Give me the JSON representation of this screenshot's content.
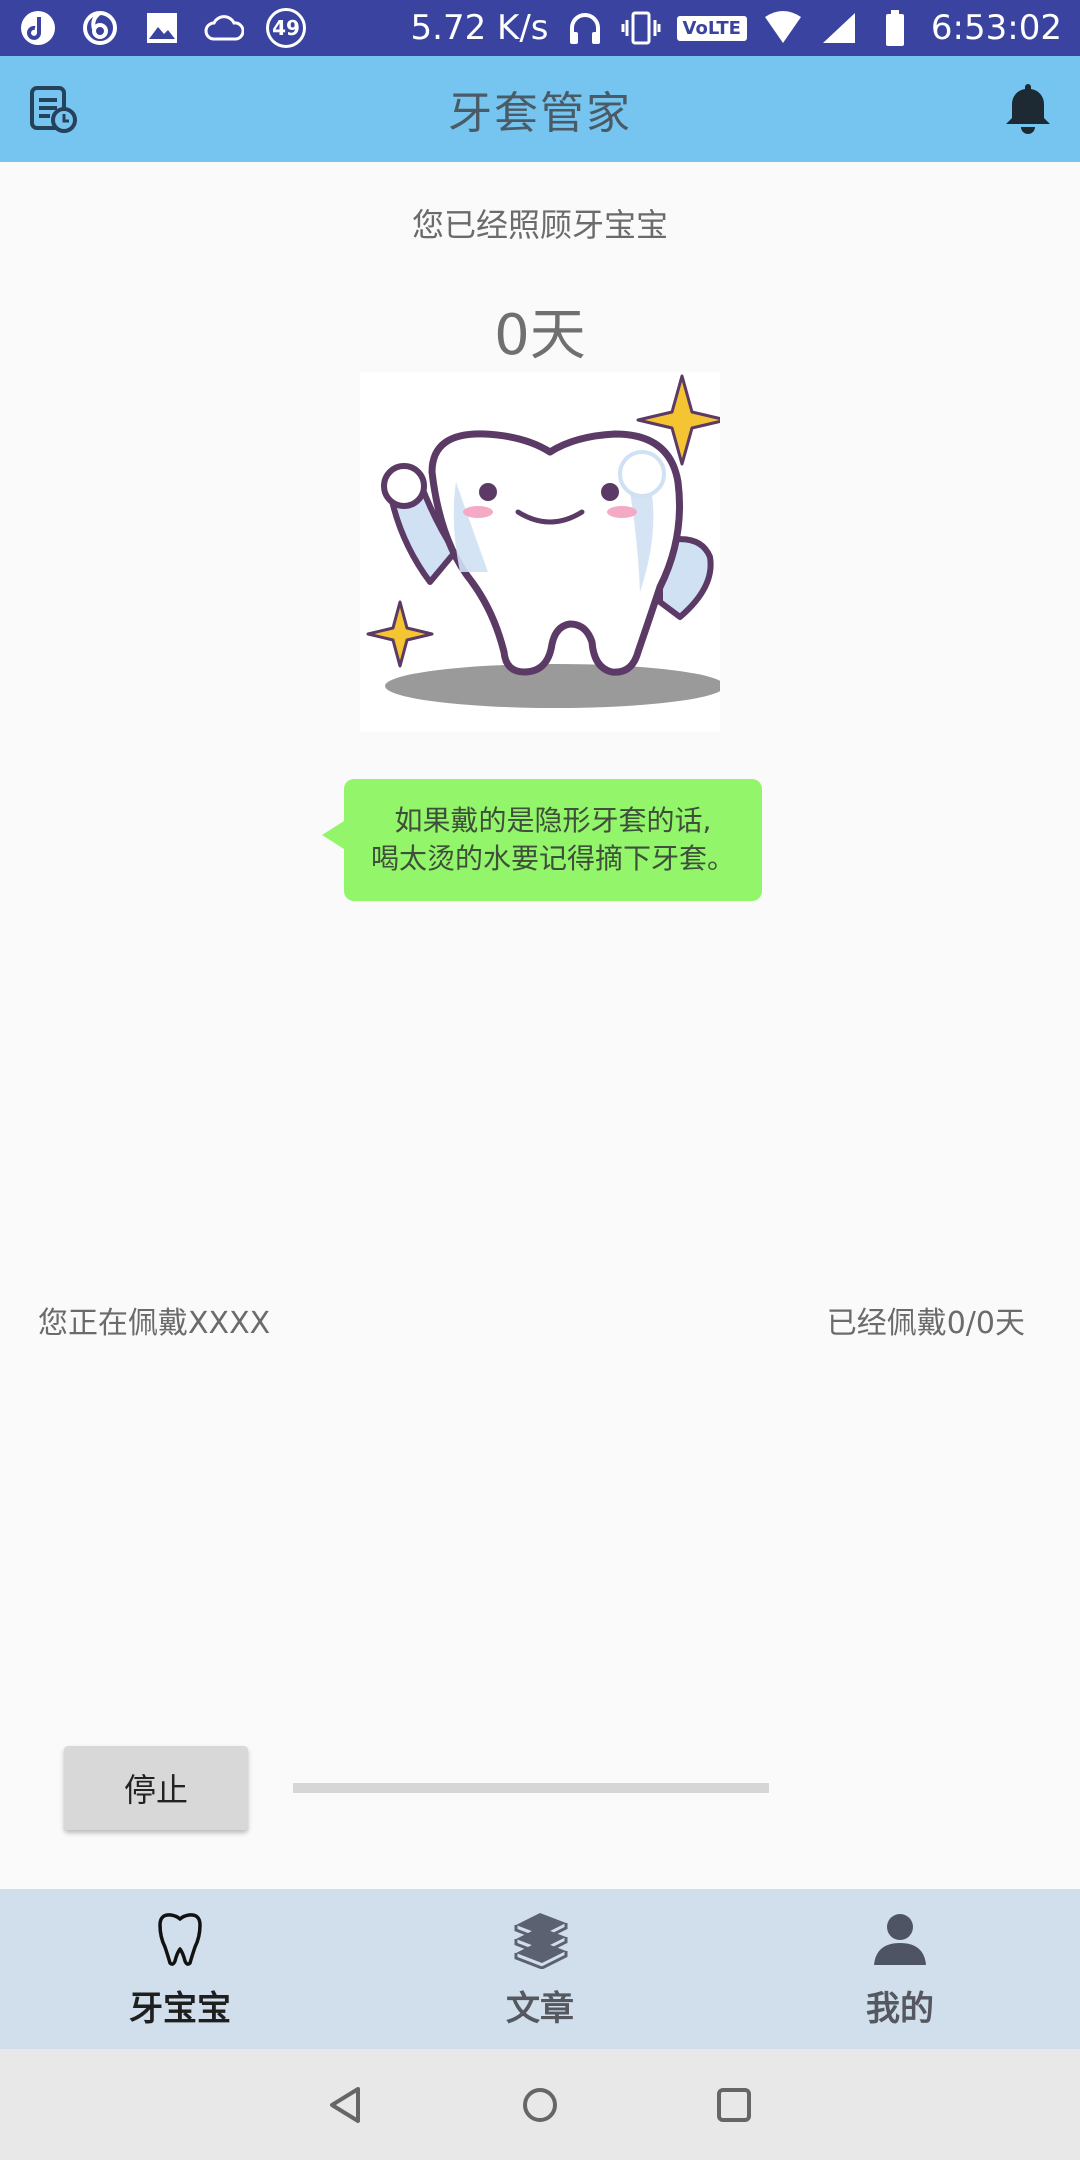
{
  "status_bar": {
    "net_speed": "5.72 K/s",
    "volte": "VoLTE",
    "time": "6:53:02",
    "notif_count": "49"
  },
  "header": {
    "title": "牙套管家",
    "left_icon": "record-icon",
    "right_icon": "bell-icon"
  },
  "main": {
    "care_label": "您已经照顾牙宝宝",
    "days_count": "0天",
    "tip_line1": "如果戴的是隐形牙套的话,",
    "tip_line2": "喝太烫的水要记得摘下牙套。",
    "wearing_text": "您正在佩戴XXXX",
    "worn_days": "已经佩戴0/0天",
    "stop_label": "停止",
    "progress": 0
  },
  "bottom_nav": {
    "items": [
      {
        "label": "牙宝宝",
        "icon": "tooth-icon",
        "active": true
      },
      {
        "label": "文章",
        "icon": "books-icon",
        "active": false
      },
      {
        "label": "我的",
        "icon": "person-icon",
        "active": false
      }
    ]
  },
  "colors": {
    "status_bar": "#3a43a0",
    "header": "#75c5f0",
    "bubble": "#92f56a",
    "bottom_nav": "#d0dfeb"
  }
}
